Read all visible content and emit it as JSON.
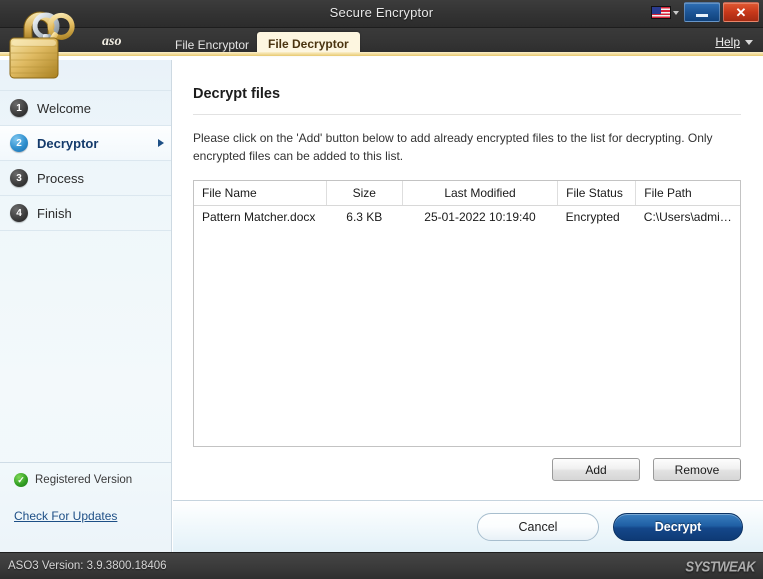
{
  "window": {
    "title": "Secure Encryptor",
    "language_flag": "us-flag-icon",
    "minimize_label": "",
    "close_label": "✕"
  },
  "tabbar": {
    "brand": "aso",
    "tabs": [
      {
        "label": "File Encryptor",
        "active": false
      },
      {
        "label": "File Decryptor",
        "active": true
      }
    ],
    "help_label": "Help"
  },
  "sidebar": {
    "items": [
      {
        "num": "1",
        "label": "Welcome",
        "active": false,
        "arrow": false
      },
      {
        "num": "2",
        "label": "Decryptor",
        "active": true,
        "arrow": true
      },
      {
        "num": "3",
        "label": "Process",
        "active": false,
        "arrow": false
      },
      {
        "num": "4",
        "label": "Finish",
        "active": false,
        "arrow": false
      }
    ],
    "registered_label": "Registered Version",
    "registered_icon": "green-check-icon",
    "update_link": "Check For Updates"
  },
  "main": {
    "title": "Decrypt files",
    "description": "Please click on the 'Add' button below to add already encrypted files to the list for decrypting. Only encrypted files can be added to this list.",
    "table": {
      "columns": [
        "File Name",
        "Size",
        "Last Modified",
        "File Status",
        "File Path"
      ],
      "rows": [
        {
          "file_name": "Pattern Matcher.docx",
          "size": "6.3 KB",
          "last_modified": "25-01-2022 10:19:40",
          "file_status": "Encrypted",
          "file_path": "C:\\Users\\admin..."
        }
      ]
    },
    "add_label": "Add",
    "remove_label": "Remove"
  },
  "footer": {
    "cancel_label": "Cancel",
    "primary_label": "Decrypt"
  },
  "statusbar": {
    "version_text": "ASO3 Version: 3.9.3800.18406",
    "watermark": "SYSTWEAK"
  },
  "colors": {
    "accent_gold": "#f4dfa0",
    "active_tab_bg": "#fdf6e0",
    "primary_blue": "#1f5fa4",
    "sidebar_bg": "#eff7fa",
    "titlebar_bg": "#333333",
    "status_green": "#34a024",
    "close_red": "#c8381a"
  }
}
